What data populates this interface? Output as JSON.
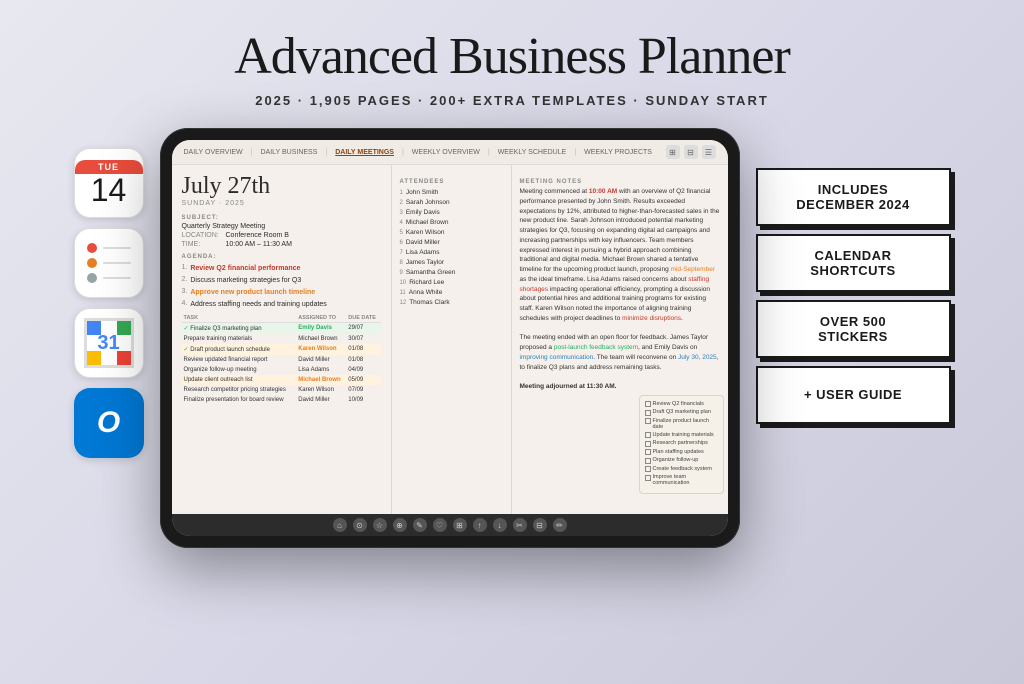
{
  "header": {
    "title": "Advanced Business Planner",
    "subtitle": "2025  ·  1,905 PAGES  ·  200+ EXTRA TEMPLATES  ·  SUNDAY START"
  },
  "left_icons": [
    {
      "id": "calendar-icon",
      "type": "calendar",
      "day": "TUE",
      "date": "14"
    },
    {
      "id": "reminders-icon",
      "type": "reminders"
    },
    {
      "id": "gcal-icon",
      "type": "google-calendar",
      "num": "31"
    },
    {
      "id": "outlook-icon",
      "type": "outlook",
      "letter": "O"
    }
  ],
  "tablet": {
    "nav": {
      "items": [
        "DAILY OVERVIEW",
        "DAILY BUSINESS",
        "DAILY MEETINGS",
        "WEEKLY OVERVIEW",
        "WEEKLY SCHEDULE",
        "WEEKLY PROJECTS"
      ],
      "active": "DAILY MEETINGS"
    },
    "date": "July 27th",
    "date_sub": "SUNDAY · 2025",
    "subject_label": "SUBJECT:",
    "subject_value": "Quarterly Strategy Meeting",
    "location_label": "LOCATION:",
    "location_value": "Conference Room B",
    "time_label": "TIME:",
    "time_value": "10:00 AM – 11:30 AM",
    "agenda_label": "AGENDA:",
    "agenda_items": [
      {
        "num": "1.",
        "text": "Review Q2 financial performance",
        "highlight": "financial performance"
      },
      {
        "num": "2.",
        "text": "Discuss marketing strategies for Q3"
      },
      {
        "num": "3.",
        "text": "Approve new product launch timeline",
        "highlight": "launch timeline"
      },
      {
        "num": "4.",
        "text": "Address staffing needs and training updates"
      }
    ],
    "attendees_label": "ATTENDEES",
    "attendees": [
      {
        "num": "1",
        "name": "John Smith"
      },
      {
        "num": "2",
        "name": "Sarah Johnson"
      },
      {
        "num": "3",
        "name": "Emily Davis"
      },
      {
        "num": "4",
        "name": "Michael Brown"
      },
      {
        "num": "5",
        "name": "Karen Wilson"
      },
      {
        "num": "6",
        "name": "David Miller"
      },
      {
        "num": "7",
        "name": "Lisa Adams"
      },
      {
        "num": "8",
        "name": "James Taylor"
      },
      {
        "num": "9",
        "name": "Samantha Green"
      },
      {
        "num": "10",
        "name": "Richard Lee"
      },
      {
        "num": "11",
        "name": "Anna White"
      },
      {
        "num": "12",
        "name": "Thomas Clark"
      }
    ],
    "meeting_notes_label": "MEETING NOTES",
    "meeting_notes": "Meeting commenced at 10:00 AM with an overview of Q2 financial performance presented by John Smith. Results exceeded expectations by 12%, attributed to higher-than-forecasted sales in the new product line. Sarah Johnson introduced potential marketing strategies for Q3, focusing on expanding digital ad campaigns and increasing partnerships with key influencers. Team members expressed interest in pursuing a hybrid approach combining traditional and digital media. Michael Brown shared a tentative timeline for the upcoming product launch, proposing mid-September as the ideal timeframe. Lisa Adams raised concerns about staffing shortages impacting operational efficiency, prompting a discussion about potential hires and additional training programs for existing staff. Karen Wilson noted the importance of aligning training schedules with project deadlines to minimize disruptions.\n\nThe meeting ended with an open floor for feedback. James Taylor proposed a post-launch feedback system, and Emily Davis on improving communication. The team will reconvene on July 30, 2025, to finalize Q3 plans and address remaining tasks.\n\nMeeting adjourned at 11:30 AM.",
    "tasks_columns": [
      "TASK",
      "ASSIGNED TO",
      "DUE DATE"
    ],
    "tasks": [
      {
        "check": true,
        "task": "Finalize Q3 marketing plan",
        "assigned": "Emily Davis",
        "due": "29/07",
        "style": "green"
      },
      {
        "check": false,
        "task": "Prepare training materials",
        "assigned": "Michael Brown",
        "due": "30/07",
        "style": "plain"
      },
      {
        "check": true,
        "task": "Draft product launch schedule",
        "assigned": "Karen Wilson",
        "due": "01/08",
        "style": "orange"
      },
      {
        "check": false,
        "task": "Review updated financial report",
        "assigned": "David Miller",
        "due": "01/08",
        "style": "plain"
      },
      {
        "check": false,
        "task": "Organize follow-up meeting",
        "assigned": "Lisa Adams",
        "due": "04/09",
        "style": "plain"
      },
      {
        "check": false,
        "task": "Update client outreach list",
        "assigned": "Michael Brown",
        "due": "05/09",
        "style": "orange"
      },
      {
        "check": false,
        "task": "Research competitor pricing strategies",
        "assigned": "Karen Wilson",
        "due": "07/09",
        "style": "plain"
      },
      {
        "check": false,
        "task": "Finalize presentation for board review",
        "assigned": "David Miller",
        "due": "10/09",
        "style": "plain"
      }
    ],
    "checklist": [
      "Review Q2 financials",
      "Draft Q3 marketing plan",
      "Finalize product launch date",
      "Update training materials",
      "Research partnerships",
      "Plan staffing updates",
      "Organize follow-up",
      "Create feedback system",
      "Improve team communication"
    ]
  },
  "badges": [
    {
      "id": "badge-december",
      "text": "INCLUDES DECEMBER 2024"
    },
    {
      "id": "badge-calendar",
      "text": "CALENDAR SHORTCUTS"
    },
    {
      "id": "badge-stickers",
      "text": "OVER 500 STICKERS"
    },
    {
      "id": "badge-guide",
      "text": "+ USER GUIDE"
    }
  ]
}
